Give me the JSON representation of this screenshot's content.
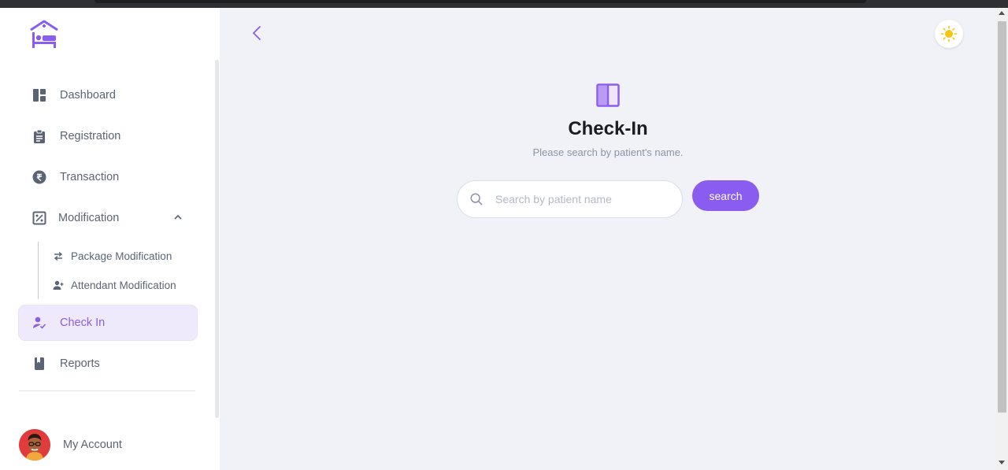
{
  "colors": {
    "accent": "#8b5cf0",
    "active_bg": "#efe9fc",
    "sidebar_text": "#5b6475",
    "page_bg": "#f1f2f8"
  },
  "logo": {
    "icon": "hospital-bed-icon"
  },
  "sidebar": {
    "items": [
      {
        "label": "Dashboard",
        "icon": "dashboard-icon"
      },
      {
        "label": "Registration",
        "icon": "clipboard-icon"
      },
      {
        "label": "Transaction",
        "icon": "rupee-icon"
      },
      {
        "label": "Modification",
        "icon": "percent-box-icon",
        "expanded": true
      }
    ],
    "sub_items": [
      {
        "label": "Package Modification",
        "icon": "swap-arrows-icon"
      },
      {
        "label": "Attendant Modification",
        "icon": "person-add-icon"
      }
    ],
    "active_item": {
      "label": "Check In",
      "icon": "person-check-icon"
    },
    "reports": {
      "label": "Reports",
      "icon": "book-icon"
    },
    "account": {
      "label": "My Account",
      "icon": "avatar"
    }
  },
  "main": {
    "back_icon": "chevron-left-icon",
    "theme_icon": "sun-icon",
    "header_icon": "columns-icon",
    "title": "Check-In",
    "subtitle": "Please search by patient's name.",
    "search": {
      "placeholder": "Search by patient name",
      "value": "",
      "button_label": "search"
    }
  }
}
